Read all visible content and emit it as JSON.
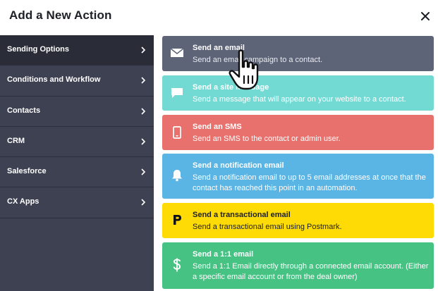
{
  "dialog": {
    "title": "Add a New Action"
  },
  "sidebar": {
    "items": [
      {
        "label": "Sending Options",
        "active": true
      },
      {
        "label": "Conditions and Workflow",
        "active": false
      },
      {
        "label": "Contacts",
        "active": false
      },
      {
        "label": "CRM",
        "active": false
      },
      {
        "label": "Salesforce",
        "active": false
      },
      {
        "label": "CX Apps",
        "active": false
      }
    ]
  },
  "actions": [
    {
      "title": "Send an email",
      "description": "Send an email campaign to a contact.",
      "icon": "envelope-icon",
      "color": "#5d6478"
    },
    {
      "title": "Send a site message",
      "description": "Send a message that will appear on your website to a contact.",
      "icon": "speech-bubble-icon",
      "color": "#72dad3"
    },
    {
      "title": "Send an SMS",
      "description": "Send an SMS to the contact or admin user.",
      "icon": "mobile-phone-icon",
      "color": "#e8716d"
    },
    {
      "title": "Send a notification email",
      "description": "Send a notification email to up to 5 email addresses at once that the contact has reached this point in an automation.",
      "icon": "bell-icon",
      "color": "#5ab4e4"
    },
    {
      "title": "Send a transactional email",
      "description": "Send a transactional email using Postmark.",
      "icon": "postmark-p-icon",
      "color": "#fedb04"
    },
    {
      "title": "Send a 1:1 email",
      "description": "Send a 1:1 Email directly through a connected email account. (Either a specific email account or from the deal owner)",
      "icon": "dollar-sign-icon",
      "color": "#46c283"
    }
  ]
}
